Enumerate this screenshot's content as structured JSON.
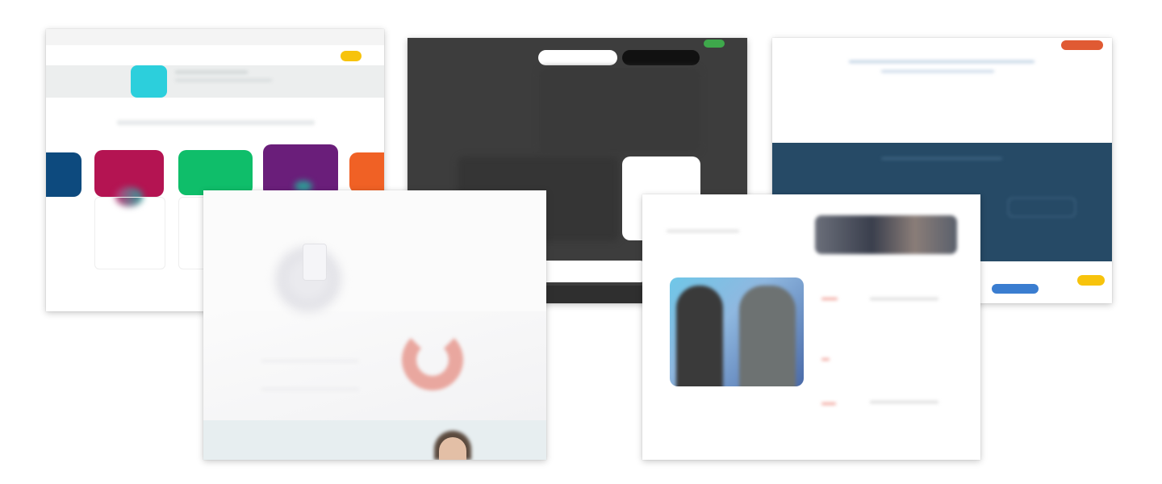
{
  "colors": {
    "background": "#ffffff",
    "cyan_tile": "#2ccfdc",
    "navy_tile": "#0d4a7e",
    "magenta_tile": "#b41452",
    "green_tile": "#0fbe6a",
    "purple_tile": "#6a1e7a",
    "orange_tile": "#f06125",
    "yellow_pill": "#f7c30c",
    "dark_panel": "#3d3d3d",
    "green_button": "#3ea84b",
    "navy_band": "#264a66",
    "orange_button": "#e05a33",
    "blue_button": "#3a7dd0",
    "salmon_ring": "#e9a79f"
  },
  "thumbnails": [
    {
      "id": "thumb-colorful-cards",
      "icon": "grid-logo-icon"
    },
    {
      "id": "thumb-dark-photo-grid",
      "icon": "none"
    },
    {
      "id": "thumb-navy-band-page",
      "icon": "none"
    },
    {
      "id": "thumb-light-hero-page",
      "icon": "avatar-icon"
    },
    {
      "id": "thumb-team-photo-page",
      "icon": "none"
    }
  ]
}
